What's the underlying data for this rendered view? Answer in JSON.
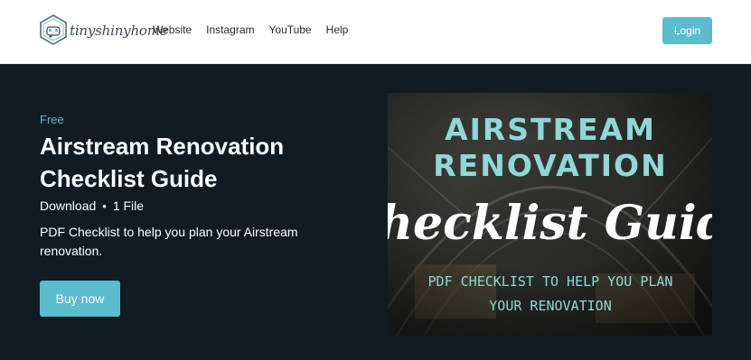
{
  "header": {
    "logo_text": "tinyshinyhome",
    "nav": [
      {
        "label": "Website"
      },
      {
        "label": "Instagram"
      },
      {
        "label": "YouTube"
      },
      {
        "label": "Help"
      }
    ],
    "login_label": "Login"
  },
  "product": {
    "price": "Free",
    "title_line1": "Airstream Renovation",
    "title_line2": "Checklist Guide",
    "type": "Download",
    "separator": "•",
    "files": "1 File",
    "description_line1": "PDF Checklist to help you plan your Airstream",
    "description_line2": "renovation.",
    "buy_label": "Buy now"
  },
  "cover": {
    "line1": "AIRSTREAM",
    "line2": "RENOVATION",
    "line3": "Checklist Guide",
    "line4": "PDF CHECKLIST TO HELP YOU PLAN",
    "line5": "YOUR RENOVATION"
  },
  "colors": {
    "accent": "#5bbccd",
    "background": "#121b22",
    "cover_title": "#8fd8d6"
  }
}
